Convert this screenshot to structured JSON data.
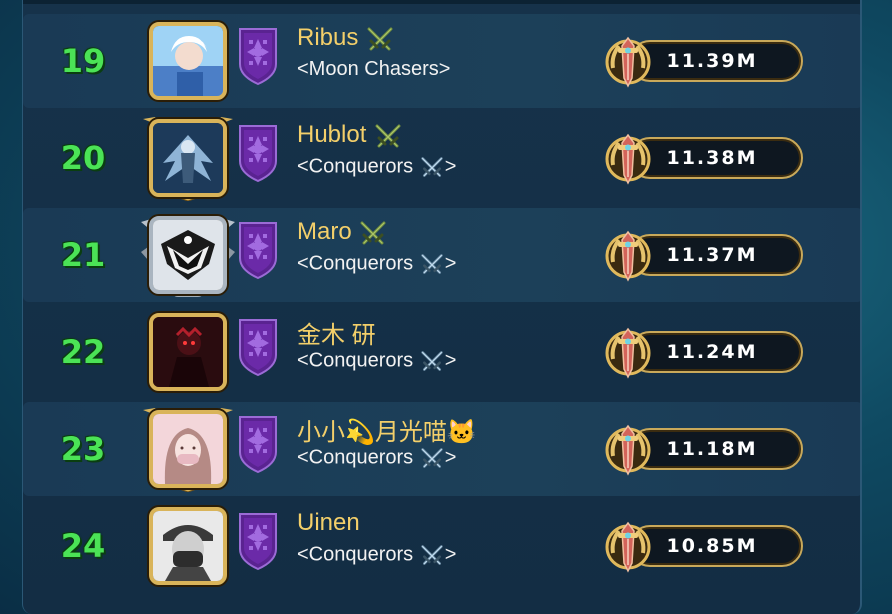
{
  "leaderboard": {
    "rows": [
      {
        "rank": "19",
        "name": "Ribus",
        "name_suffix": "⚔",
        "clan": "<Moon Chasers>",
        "clan_suffix": "",
        "power": "11.39M",
        "avatar": "ice-character-avatar",
        "frame": "plain-gold"
      },
      {
        "rank": "20",
        "name": "Hublot ",
        "name_suffix": "⚔",
        "clan": "<Conquerors",
        "clan_suffix": ">",
        "power": "11.38M",
        "avatar": "dark-angel-avatar",
        "frame": "gold-winged"
      },
      {
        "rank": "21",
        "name": "Maro",
        "name_suffix": "⚔",
        "clan": "<Conquerors",
        "clan_suffix": ">",
        "power": "11.37M",
        "avatar": "eagle-crest-avatar",
        "frame": "silver-winged"
      },
      {
        "rank": "22",
        "name": "金木 研",
        "name_suffix": "",
        "clan": "<Conquerors",
        "clan_suffix": ">",
        "power": "11.24M",
        "avatar": "dark-warrior-avatar",
        "frame": "plain-gold"
      },
      {
        "rank": "23",
        "name": "小小💫月光喵🐱",
        "name_suffix": "",
        "clan": "<Conquerors",
        "clan_suffix": ">",
        "power": "11.18M",
        "avatar": "girl-portrait-avatar",
        "frame": "gold-winged"
      },
      {
        "rank": "24",
        "name": "Uinen",
        "name_suffix": "",
        "clan": "<Conquerors",
        "clan_suffix": ">",
        "power": "10.85M",
        "avatar": "masked-person-avatar",
        "frame": "plain-gold"
      }
    ]
  },
  "colors": {
    "rank_green": "#4be356",
    "name_gold": "#f3cf6a",
    "clan_badge_purple": "#6b2aa8",
    "power_border": "#c9a95a"
  },
  "icons": {
    "clan_badge": "purple-shield-icon",
    "power": "sword-laurel-icon",
    "swords": "crossed-swords-icon"
  }
}
